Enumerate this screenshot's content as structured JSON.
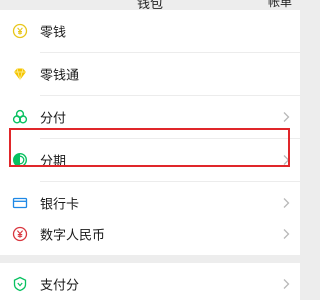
{
  "header": {
    "title": "钱包",
    "action": "帐单"
  },
  "group1": {
    "items": [
      {
        "label": "零钱",
        "icon": "yen-coin-icon"
      },
      {
        "label": "零钱通",
        "icon": "diamond-icon"
      },
      {
        "label": "分付",
        "icon": "fenfu-icon"
      },
      {
        "label": "分期",
        "icon": "installment-icon"
      },
      {
        "label": "银行卡",
        "icon": "bank-card-icon"
      }
    ]
  },
  "group2": {
    "items": [
      {
        "label": "数字人民币",
        "icon": "digital-yuan-icon"
      }
    ]
  },
  "group3": {
    "items": [
      {
        "label": "支付分",
        "icon": "pay-score-icon"
      }
    ]
  },
  "highlight": {
    "target": "分期",
    "color": "#e0262a"
  },
  "colors": {
    "accent": "#07c160",
    "gold": "#f5c400",
    "blue": "#1e88e5",
    "red": "#d9363e"
  }
}
